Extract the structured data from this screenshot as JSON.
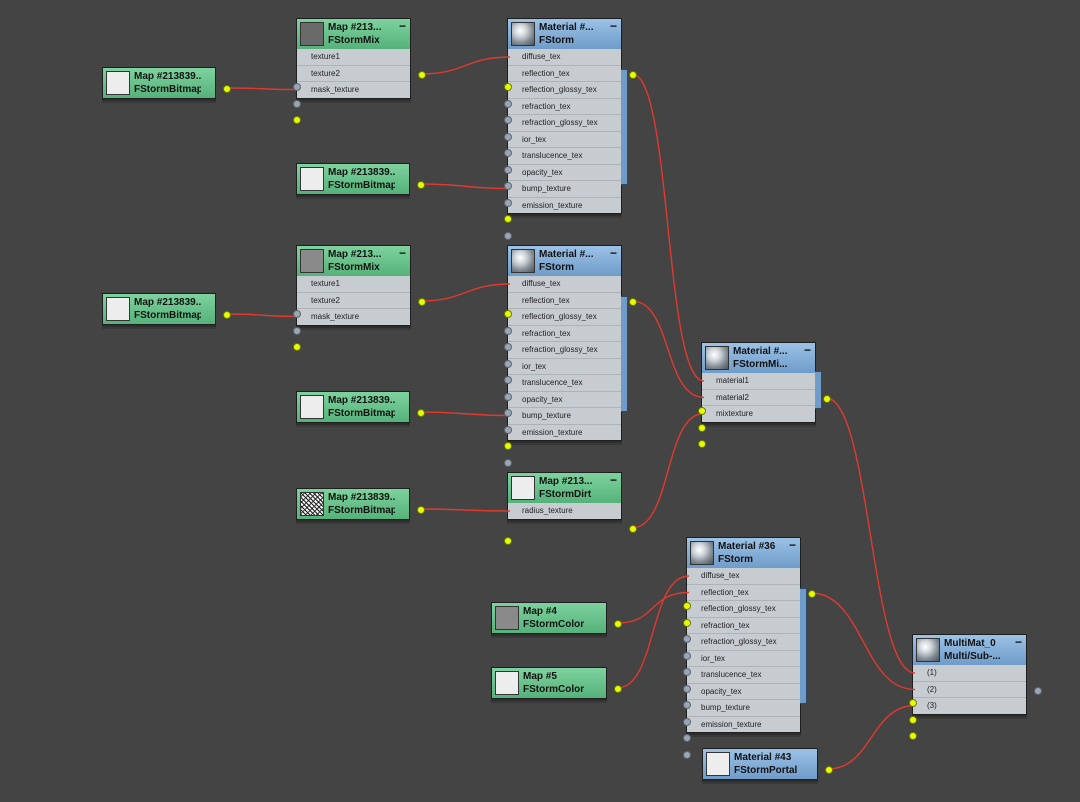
{
  "nodes": {
    "bmp1": {
      "title": "Map #213839...",
      "type": "FStormBitmap"
    },
    "mix1": {
      "title": "Map #213...",
      "type": "FStormMix",
      "rows": [
        "texture1",
        "texture2",
        "mask_texture"
      ]
    },
    "mat1": {
      "title": "Material #...",
      "type": "FStorm",
      "rows": [
        "diffuse_tex",
        "reflection_tex",
        "reflection_glossy_tex",
        "refraction_tex",
        "refraction_glossy_tex",
        "ior_tex",
        "translucence_tex",
        "opacity_tex",
        "bump_texture",
        "emission_texture"
      ]
    },
    "bmp2": {
      "title": "Map #213839...",
      "type": "FStormBitmap"
    },
    "bmp3": {
      "title": "Map #213839...",
      "type": "FStormBitmap"
    },
    "mix2": {
      "title": "Map #213...",
      "type": "FStormMix",
      "rows": [
        "texture1",
        "texture2",
        "mask_texture"
      ]
    },
    "mat2": {
      "title": "Material #...",
      "type": "FStorm",
      "rows": [
        "diffuse_tex",
        "reflection_tex",
        "reflection_glossy_tex",
        "refraction_tex",
        "refraction_glossy_tex",
        "ior_tex",
        "translucence_tex",
        "opacity_tex",
        "bump_texture",
        "emission_texture"
      ]
    },
    "bmp4": {
      "title": "Map #213839...",
      "type": "FStormBitmap"
    },
    "bmp5": {
      "title": "Map #213839...",
      "type": "FStormBitmap"
    },
    "dirt": {
      "title": "Map #213...",
      "type": "FStormDirt",
      "rows": [
        "radius_texture"
      ]
    },
    "matmix": {
      "title": "Material #...",
      "type": "FStormMi...",
      "rows": [
        "material1",
        "material2",
        "mixtexture"
      ]
    },
    "mat36": {
      "title": "Material #36",
      "type": "FStorm",
      "rows": [
        "diffuse_tex",
        "reflection_tex",
        "reflection_glossy_tex",
        "refraction_tex",
        "refraction_glossy_tex",
        "ior_tex",
        "translucence_tex",
        "opacity_tex",
        "bump_texture",
        "emission_texture"
      ]
    },
    "col4": {
      "title": "Map #4",
      "type": "FStormColor"
    },
    "col5": {
      "title": "Map #5",
      "type": "FStormColor"
    },
    "mat43": {
      "title": "Material #43",
      "type": "FStormPortal"
    },
    "multi": {
      "title": "MultiMat_0",
      "type": "Multi/Sub-...",
      "rows": [
        "(1)",
        "(2)",
        "(3)"
      ]
    }
  },
  "connections": [
    [
      "bmp1",
      "mix1",
      2
    ],
    [
      "mix1",
      "mat1",
      0
    ],
    [
      "bmp2",
      "mat1",
      8
    ],
    [
      "bmp3",
      "mix2",
      2
    ],
    [
      "mix2",
      "mat2",
      0
    ],
    [
      "bmp4",
      "mat2",
      8
    ],
    [
      "bmp5",
      "dirt",
      0
    ],
    [
      "mat1",
      "matmix",
      0
    ],
    [
      "mat2",
      "matmix",
      1
    ],
    [
      "dirt",
      "matmix",
      2
    ],
    [
      "col4",
      "mat36",
      1
    ],
    [
      "col5",
      "mat36",
      0
    ],
    [
      "matmix",
      "multi",
      0
    ],
    [
      "mat36",
      "multi",
      1
    ],
    [
      "mat43",
      "multi",
      2
    ]
  ],
  "colors": {
    "background": "#444444",
    "map_node": "#55b27a",
    "material_node": "#6f9cc9",
    "active_port": "#e6ff00",
    "inactive_port": "#9aa6b4",
    "wire": "#e0392e"
  }
}
